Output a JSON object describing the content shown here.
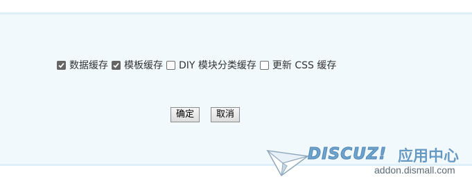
{
  "options": [
    {
      "label": "数据缓存",
      "checked": true
    },
    {
      "label": "模板缓存",
      "checked": true
    },
    {
      "label": "DIY 模块分类缓存",
      "checked": false
    },
    {
      "label": "更新 CSS 缓存",
      "checked": false
    }
  ],
  "buttons": {
    "confirm": "确定",
    "cancel": "取消"
  },
  "watermark": {
    "logo_text": "DISCUZ!",
    "cn_text": "应用中心",
    "url": "addon.dismall.com"
  },
  "colors": {
    "panel_bg": "#f2f9fd",
    "panel_border": "#deeffa",
    "checkbox_checked": "#656565",
    "watermark": "#6fa3cc"
  }
}
